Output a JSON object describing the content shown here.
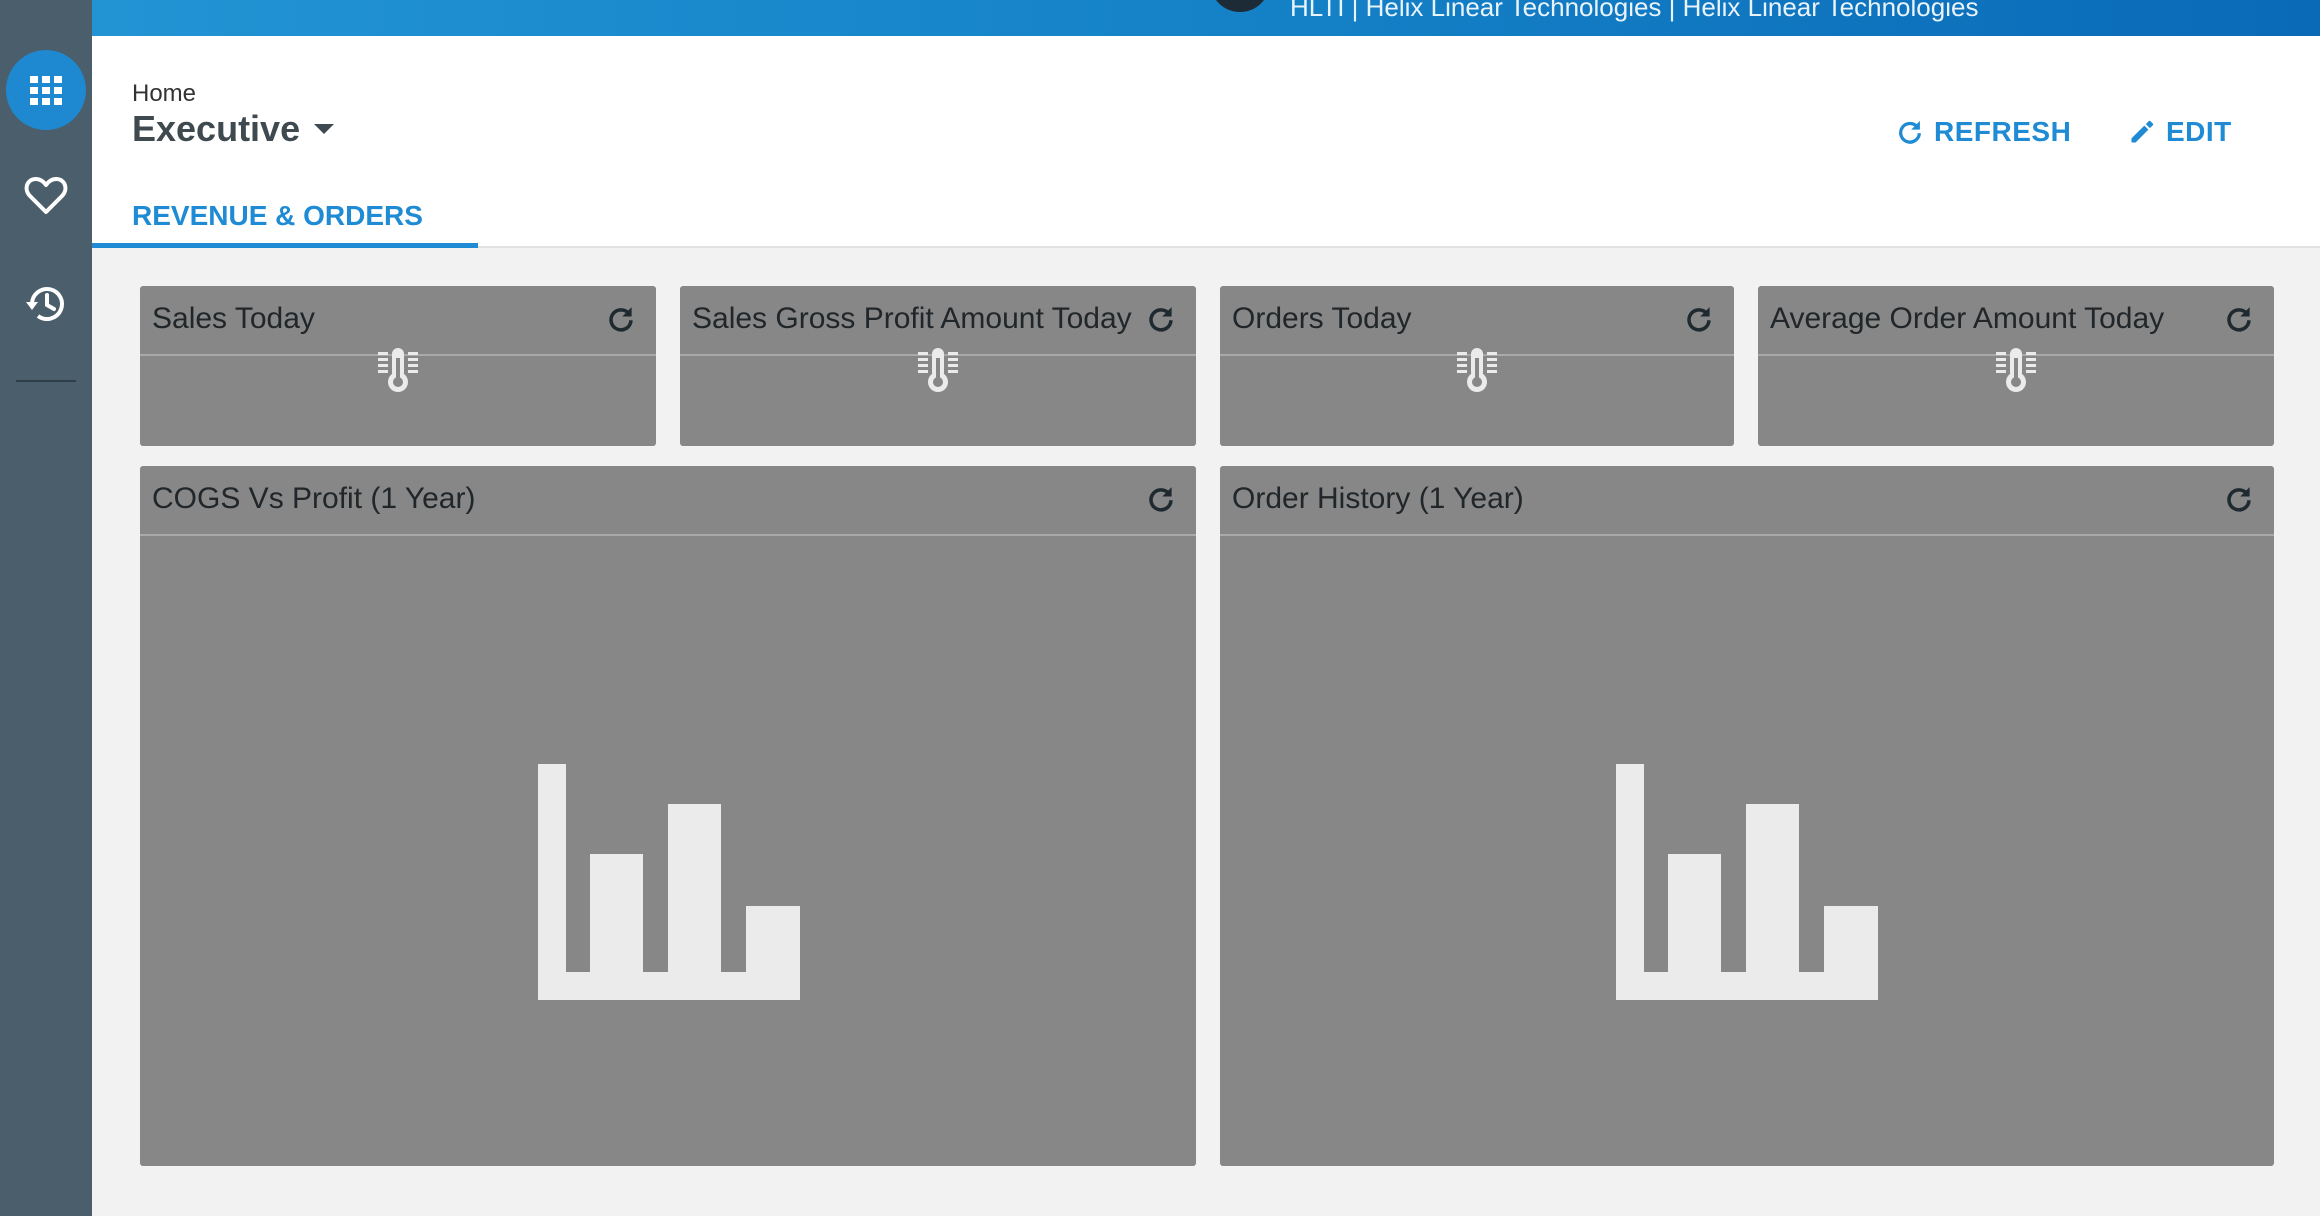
{
  "topbar": {
    "tenant": "HLTI | Helix Linear Technologies | Helix Linear Technologies"
  },
  "sidebar": {
    "items": [
      {
        "name": "apps",
        "icon": "grid-icon",
        "active": true
      },
      {
        "name": "favorites",
        "icon": "heart-icon",
        "active": false
      },
      {
        "name": "history",
        "icon": "history-icon",
        "active": false
      }
    ]
  },
  "header": {
    "breadcrumb": "Home",
    "title": "Executive",
    "refresh_label": "REFRESH",
    "edit_label": "EDIT",
    "tabs": [
      {
        "label": "REVENUE & ORDERS",
        "active": true
      }
    ]
  },
  "widgets": {
    "kpis": [
      {
        "title": "Sales Today",
        "icon": "thermometer-icon"
      },
      {
        "title": "Sales Gross Profit Amount Today",
        "icon": "thermometer-icon"
      },
      {
        "title": "Orders Today",
        "icon": "thermometer-icon"
      },
      {
        "title": "Average Order Amount Today",
        "icon": "thermometer-icon"
      }
    ],
    "charts": [
      {
        "title": "COGS Vs Profit (1 Year)",
        "icon": "bar-chart-placeholder-icon"
      },
      {
        "title": "Order History (1 Year)",
        "icon": "bar-chart-placeholder-icon"
      }
    ]
  },
  "colors": {
    "accent": "#1e8bd4",
    "rail": "#4a5f6b",
    "widget_bg": "#878787",
    "placeholder": "#ebebeb"
  }
}
